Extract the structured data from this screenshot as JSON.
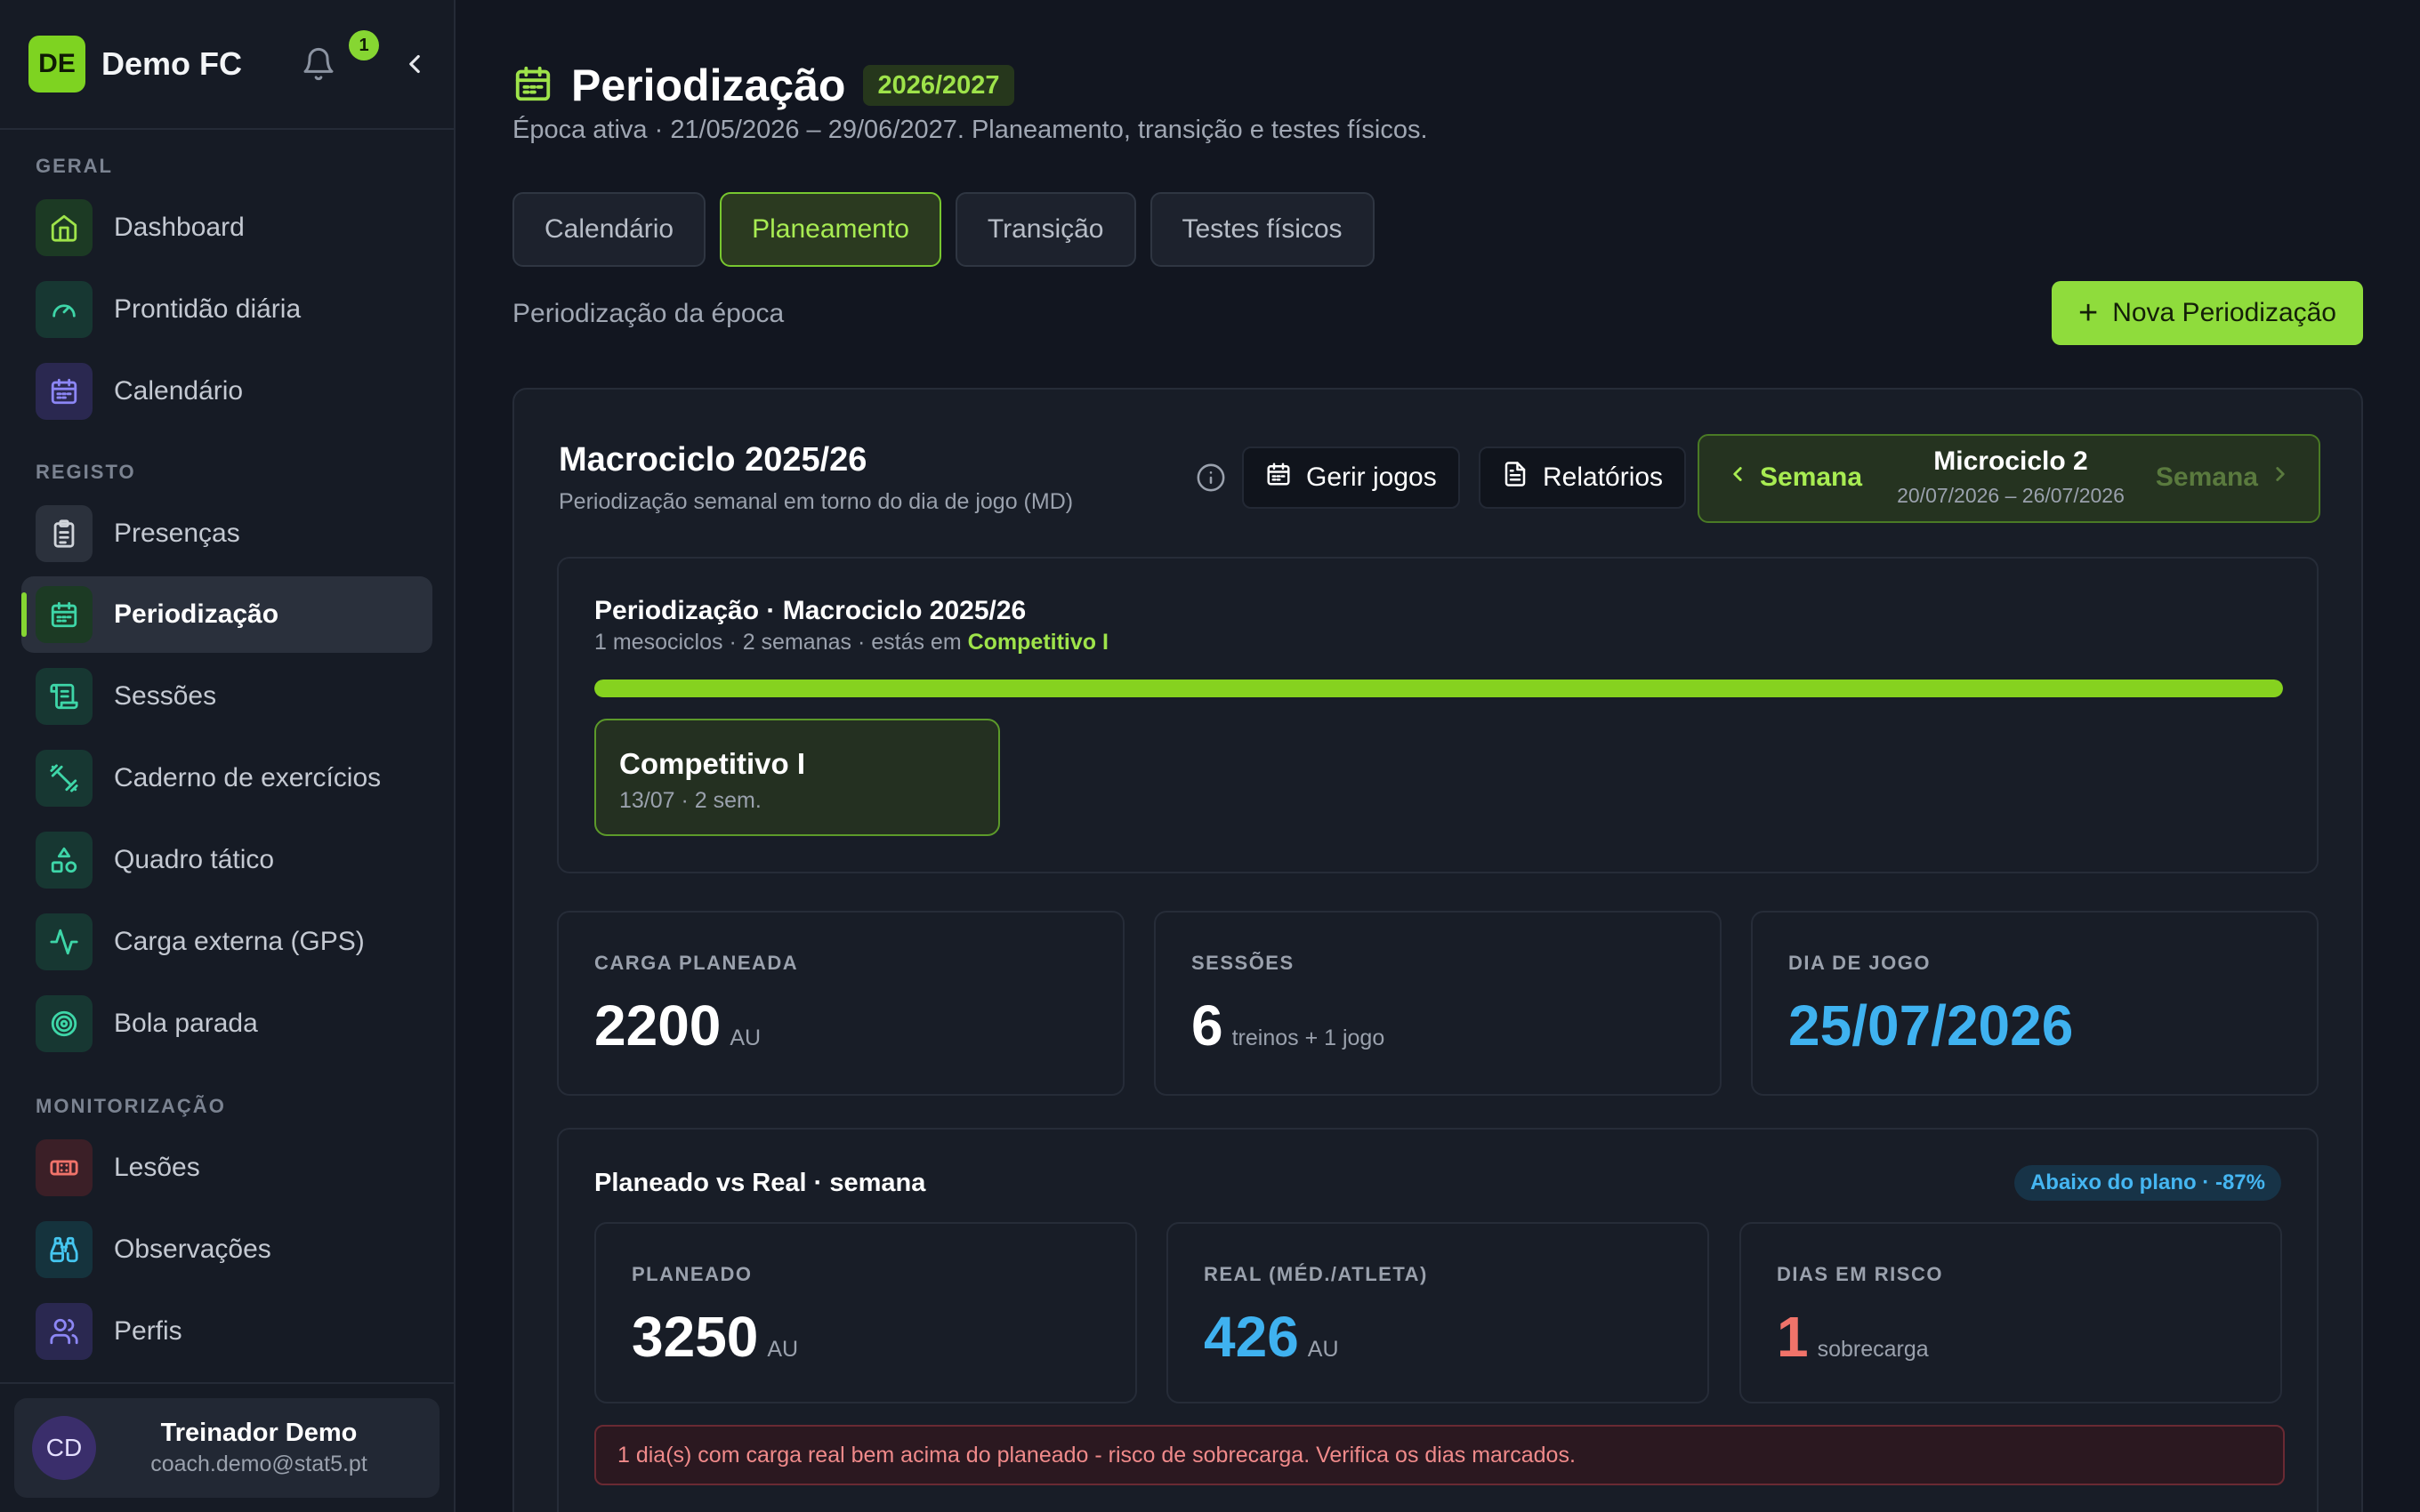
{
  "brand": {
    "initials": "DE",
    "name": "Demo FC",
    "notification_count": "1"
  },
  "sidebar": {
    "sections": {
      "geral": "GERAL",
      "registo": "REGISTO",
      "monitorizacao": "MONITORIZAÇÃO"
    },
    "items": [
      {
        "label": "Dashboard",
        "icon": "home-icon"
      },
      {
        "label": "Prontidão diária",
        "icon": "gauge-icon"
      },
      {
        "label": "Calendário",
        "icon": "calendar-icon"
      },
      {
        "label": "Presenças",
        "icon": "clipboard-icon"
      },
      {
        "label": "Periodização",
        "icon": "calendar-grid-icon",
        "active": true
      },
      {
        "label": "Sessões",
        "icon": "scroll-icon"
      },
      {
        "label": "Caderno de exercícios",
        "icon": "dumbbell-icon"
      },
      {
        "label": "Quadro tático",
        "icon": "shapes-icon"
      },
      {
        "label": "Carga externa (GPS)",
        "icon": "activity-icon"
      },
      {
        "label": "Bola parada",
        "icon": "target-icon"
      },
      {
        "label": "Lesões",
        "icon": "bandage-icon"
      },
      {
        "label": "Observações",
        "icon": "binoculars-icon"
      },
      {
        "label": "Perfis",
        "icon": "users-icon"
      }
    ],
    "user": {
      "initials": "CD",
      "name": "Treinador Demo",
      "email": "coach.demo@stat5.pt"
    }
  },
  "header": {
    "title": "Periodização",
    "season": "2026/2027",
    "subtitle": "Época ativa · 21/05/2026 – 29/06/2027. Planeamento, transição e testes físicos."
  },
  "tabs": [
    {
      "label": "Calendário"
    },
    {
      "label": "Planeamento",
      "active": true
    },
    {
      "label": "Transição"
    },
    {
      "label": "Testes físicos"
    }
  ],
  "section_label": "Periodização da época",
  "new_button": "Nova Periodização",
  "macro": {
    "title": "Macrociclo 2025/26",
    "subtitle": "Periodização semanal em torno do dia de jogo (MD)",
    "manage_games": "Gerir jogos",
    "reports": "Relatórios",
    "week_prev": "Semana",
    "week_next": "Semana",
    "micro_title": "Microciclo 2",
    "micro_dates": "20/07/2026 – 26/07/2026"
  },
  "periodization": {
    "title": "Periodização · Macrociclo 2025/26",
    "sub_prefix": "1 mesociclos · 2 semanas · estás em",
    "current_phase": "Competitivo I",
    "progress": 1.0,
    "meso": {
      "name": "Competitivo I",
      "meta": "13/07 · 2 sem."
    }
  },
  "stats": {
    "planned_load": {
      "label": "CARGA PLANEADA",
      "value": "2200",
      "unit": "AU"
    },
    "sessions": {
      "label": "SESSÕES",
      "value": "6",
      "unit": "treinos + 1 jogo"
    },
    "match_day": {
      "label": "DIA DE JOGO",
      "value": "25/07/2026"
    }
  },
  "planned_vs_real": {
    "title": "Planeado vs Real · semana",
    "badge": "Abaixo do plano · -87%",
    "planned": {
      "label": "PLANEADO",
      "value": "3250",
      "unit": "AU"
    },
    "real": {
      "label": "REAL (MÉD./ATLETA)",
      "value": "426",
      "unit": "AU"
    },
    "risk": {
      "label": "DIAS EM RISCO",
      "value": "1",
      "unit": "sobrecarga"
    },
    "alert": "1 dia(s) com carga real bem acima do planeado - risco de sobrecarga. Verifica os dias marcados."
  },
  "colors": {
    "accent": "#86d632",
    "blue": "#3fb2f0",
    "danger": "#f0736a"
  }
}
